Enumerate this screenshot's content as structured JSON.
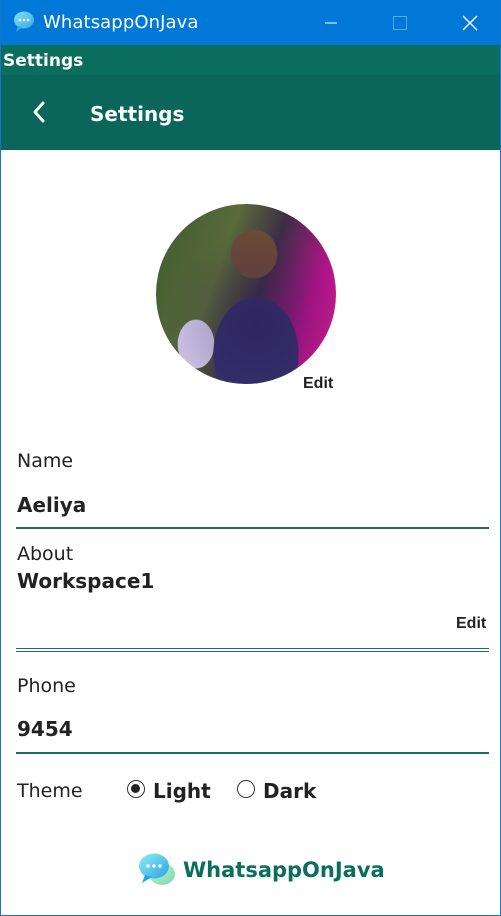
{
  "window": {
    "title": "WhatsappOnJava",
    "app_icon": "chat-bubble-icon",
    "controls": [
      "minimize-icon",
      "maximize-icon",
      "close-icon"
    ],
    "titlebar_color": "#0078d7"
  },
  "strip": {
    "label": "Settings",
    "color": "#0b6e5d"
  },
  "header": {
    "title": "Settings",
    "back_icon": "chevron-left-icon",
    "color": "#0a6658"
  },
  "profile": {
    "avatar": "profile-photo",
    "edit_label": "Edit"
  },
  "fields": {
    "name": {
      "label": "Name",
      "value": "Aeliya"
    },
    "about": {
      "label": "About",
      "value": "Workspace1",
      "edit_label": "Edit"
    },
    "phone": {
      "label": "Phone",
      "value": "9454"
    }
  },
  "theme": {
    "label": "Theme",
    "options": [
      {
        "label": "Light",
        "selected": true
      },
      {
        "label": "Dark",
        "selected": false
      }
    ]
  },
  "footer": {
    "brand": "WhatsappOnJava",
    "logo": "chat-bubble-icon",
    "brand_color": "#0b6e5d"
  }
}
